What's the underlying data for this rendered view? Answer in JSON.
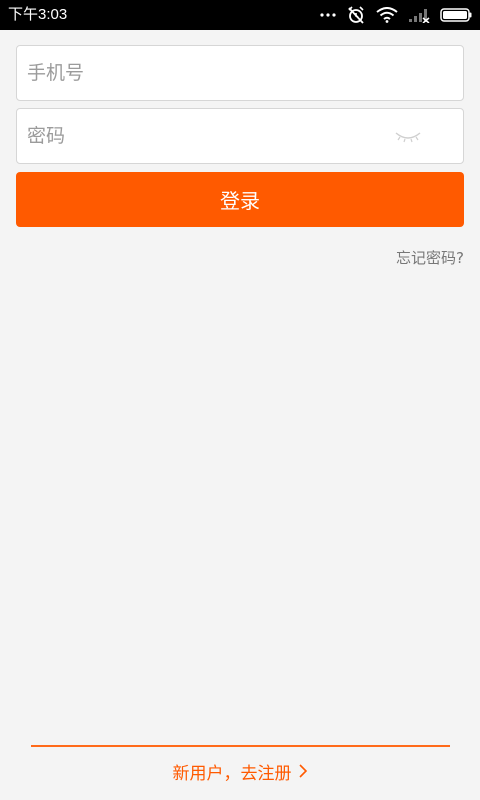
{
  "status_bar": {
    "time": "下午3:03",
    "icons": [
      "more-dots-icon",
      "alarm-off-icon",
      "wifi-icon",
      "signal-icon",
      "battery-icon"
    ]
  },
  "login_form": {
    "phone_placeholder": "手机号",
    "phone_value": "",
    "password_placeholder": "密码",
    "password_value": "",
    "password_visibility_icon": "eye-closed-icon",
    "submit_label": "登录",
    "forgot_password_label": "忘记密码?"
  },
  "footer": {
    "register_label": "新用户，去注册",
    "register_icon": "chevron-right-icon"
  },
  "colors": {
    "accent": "#ff5a00",
    "background": "#f4f4f4",
    "status_bar": "#000000"
  }
}
